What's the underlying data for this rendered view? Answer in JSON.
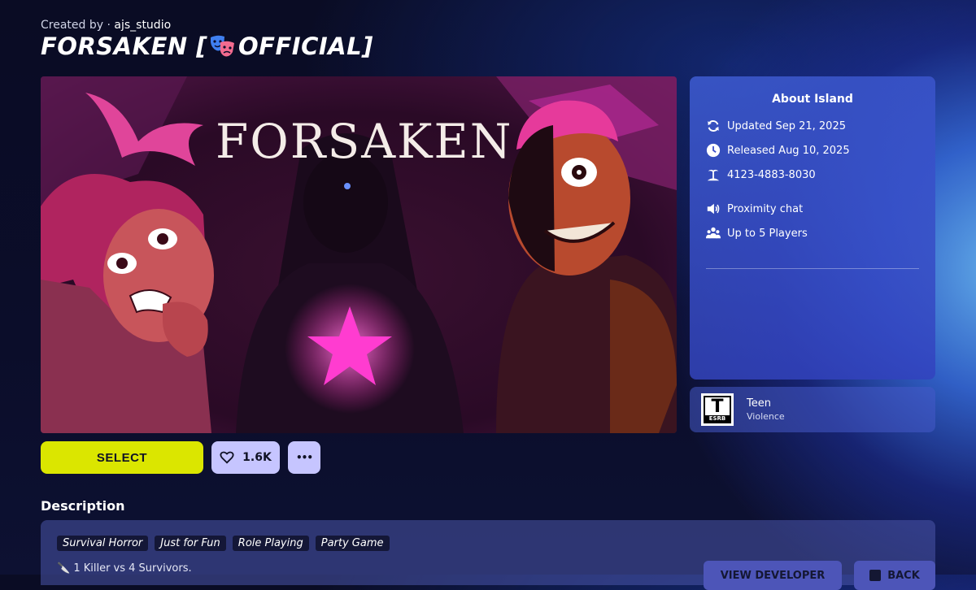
{
  "header": {
    "created_by_prefix": "Created by · ",
    "creator_name": "ajs_studio",
    "title_start": "FORSAKEN [",
    "title_end": "OFFICIAL]"
  },
  "hero": {
    "logo_text": "FORSAKEN"
  },
  "about": {
    "heading": "About Island",
    "updated": "Updated Sep 21, 2025",
    "released": "Released Aug 10, 2025",
    "island_code": "4123-4883-8030",
    "feature_1": "Proximity chat",
    "feature_2": "Up to 5 Players"
  },
  "rating": {
    "badge": "T",
    "badge_sub": "ESRB",
    "rating": "Teen",
    "descriptor": "Violence"
  },
  "actions": {
    "select_label": "SELECT",
    "like_count": "1.6K",
    "more_label": "•••"
  },
  "description": {
    "label": "Description",
    "tags": [
      "Survival Horror",
      "Just for Fun",
      "Role Playing",
      "Party Game"
    ],
    "text": "🔪 1 Killer vs 4 Survivors.",
    "view_developer": "VIEW DEVELOPER",
    "back": "BACK"
  },
  "colors": {
    "select_button": "#dbe600",
    "like_button": "#c6c5ff",
    "panel": "#3e5cd2"
  }
}
